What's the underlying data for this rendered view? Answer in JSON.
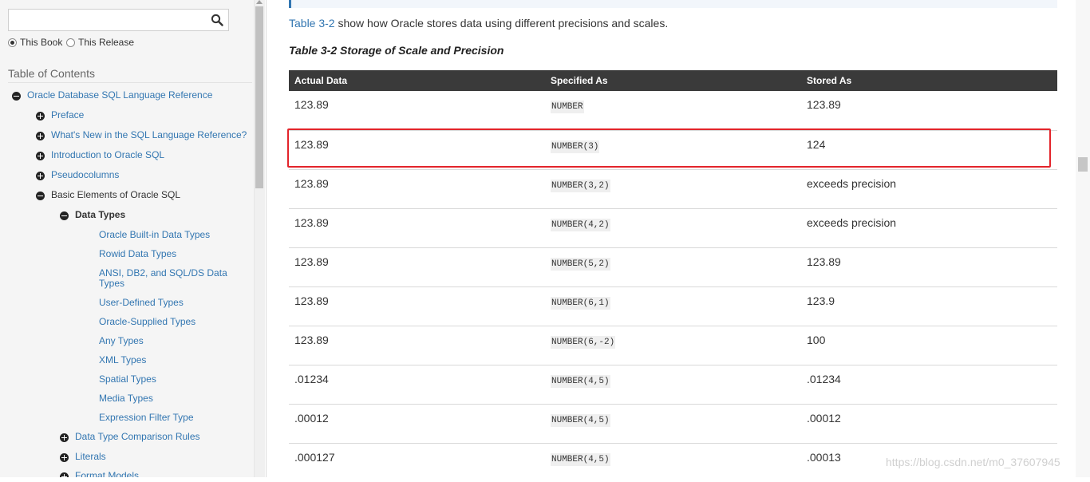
{
  "sidebar": {
    "search": {
      "value": "",
      "placeholder": ""
    },
    "scope_options": [
      {
        "label": "This Book",
        "checked": true
      },
      {
        "label": "This Release",
        "checked": false
      }
    ],
    "toc_heading": "Table of Contents",
    "toc": [
      {
        "label": "Oracle Database SQL Language Reference",
        "sign": "minus",
        "level": 0
      },
      {
        "label": "Preface",
        "sign": "plus",
        "level": 1
      },
      {
        "label": "What's New in the SQL Language Reference?",
        "sign": "plus",
        "level": 1
      },
      {
        "label": "Introduction to Oracle SQL",
        "sign": "plus",
        "level": 1
      },
      {
        "label": "Pseudocolumns",
        "sign": "plus",
        "level": 1
      },
      {
        "label": "Basic Elements of Oracle SQL",
        "sign": "minus",
        "level": 1,
        "style": "dark"
      },
      {
        "label": "Data Types",
        "sign": "minus",
        "level": 2,
        "style": "bold"
      },
      {
        "label": "Oracle Built-in Data Types",
        "level": 3
      },
      {
        "label": "Rowid Data Types",
        "level": 3
      },
      {
        "label": "ANSI, DB2, and SQL/DS Data Types",
        "level": 3,
        "multiline": true
      },
      {
        "label": "User-Defined Types",
        "level": 3
      },
      {
        "label": "Oracle-Supplied Types",
        "level": 3
      },
      {
        "label": "Any Types",
        "level": 3
      },
      {
        "label": "XML Types",
        "level": 3
      },
      {
        "label": "Spatial Types",
        "level": 3
      },
      {
        "label": "Media Types",
        "level": 3
      },
      {
        "label": "Expression Filter Type",
        "level": 3
      },
      {
        "label": "Data Type Comparison Rules",
        "sign": "plus",
        "level": 2
      },
      {
        "label": "Literals",
        "sign": "plus",
        "level": 2
      },
      {
        "label": "Format Models",
        "sign": "plus",
        "level": 2
      }
    ]
  },
  "main": {
    "intro_link": "Table 3-2",
    "intro_text": " show how Oracle stores data using different precisions and scales.",
    "table_title": "Table 3-2 Storage of Scale and Precision",
    "columns": [
      "Actual Data",
      "Specified As",
      "Stored As"
    ],
    "rows": [
      {
        "actual": "123.89",
        "specified": "NUMBER",
        "stored": "123.89"
      },
      {
        "actual": "123.89",
        "specified": "NUMBER(3)",
        "stored": "124",
        "highlighted": true
      },
      {
        "actual": "123.89",
        "specified": "NUMBER(3,2)",
        "stored": "exceeds precision"
      },
      {
        "actual": "123.89",
        "specified": "NUMBER(4,2)",
        "stored": "exceeds precision"
      },
      {
        "actual": "123.89",
        "specified": "NUMBER(5,2)",
        "stored": "123.89"
      },
      {
        "actual": "123.89",
        "specified": "NUMBER(6,1)",
        "stored": "123.9"
      },
      {
        "actual": "123.89",
        "specified": "NUMBER(6,-2)",
        "stored": "100"
      },
      {
        "actual": ".01234",
        "specified": "NUMBER(4,5)",
        "stored": ".01234"
      },
      {
        "actual": ".00012",
        "specified": "NUMBER(4,5)",
        "stored": ".00012"
      },
      {
        "actual": ".000127",
        "specified": "NUMBER(4,5)",
        "stored": ".00013"
      }
    ]
  },
  "watermark": "https://blog.csdn.net/m0_37607945",
  "colors": {
    "link": "#3276b1",
    "header_bg": "#3a3a3a",
    "highlight": "#e3242b"
  }
}
